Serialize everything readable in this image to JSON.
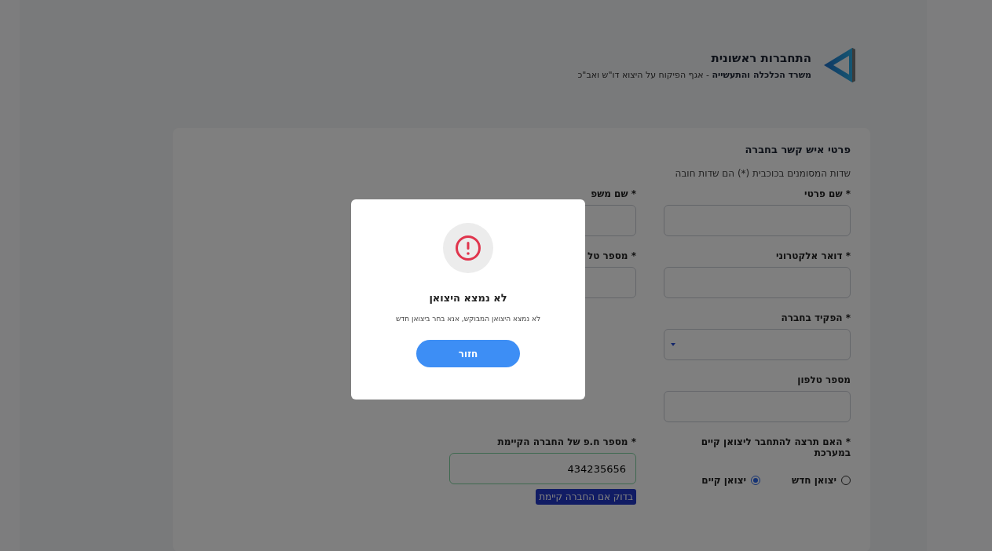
{
  "header": {
    "title": "התחברות ראשונית",
    "subtitle": "**משרד הכלכלה והתעשייה** - אגף הפיקוח על היצוא דו\"ש ואב\"כ"
  },
  "form": {
    "title": "פרטי איש קשר בחברה",
    "note": "שדות המסומנים בכוכבית (*) הם שדות חובה",
    "rows": [
      [
        {
          "kind": "text",
          "label": "* שם פרטי"
        },
        {
          "kind": "text",
          "label": "* שם משפ"
        }
      ],
      [
        {
          "kind": "text",
          "label": "* דואר אלקטרוני"
        },
        {
          "kind": "text",
          "label": "* מספר טל"
        }
      ],
      [
        {
          "kind": "select",
          "label": "* הפקיד בחברה"
        }
      ],
      [
        {
          "kind": "text",
          "label": "מספר טלפון"
        }
      ],
      [
        {
          "kind": "radio",
          "label": "* האם תרצה להתחבר ליצואן קיים במערכת",
          "options": [
            {
              "label": "יצואן חדש",
              "selected": false
            },
            {
              "label": "יצואן קיים",
              "selected": true
            }
          ]
        },
        {
          "kind": "check",
          "label": "* מספר ח.פ של החברה הקיימת",
          "value": "434235656",
          "valid": true,
          "button": "בדוק אם החברה קיימת"
        }
      ]
    ]
  },
  "dialog": {
    "title": "לא נמצא היצואן",
    "message": "לא נמצא היצואן המבוקש, אנא בחר ביצואן חדש",
    "button": "חזור"
  }
}
